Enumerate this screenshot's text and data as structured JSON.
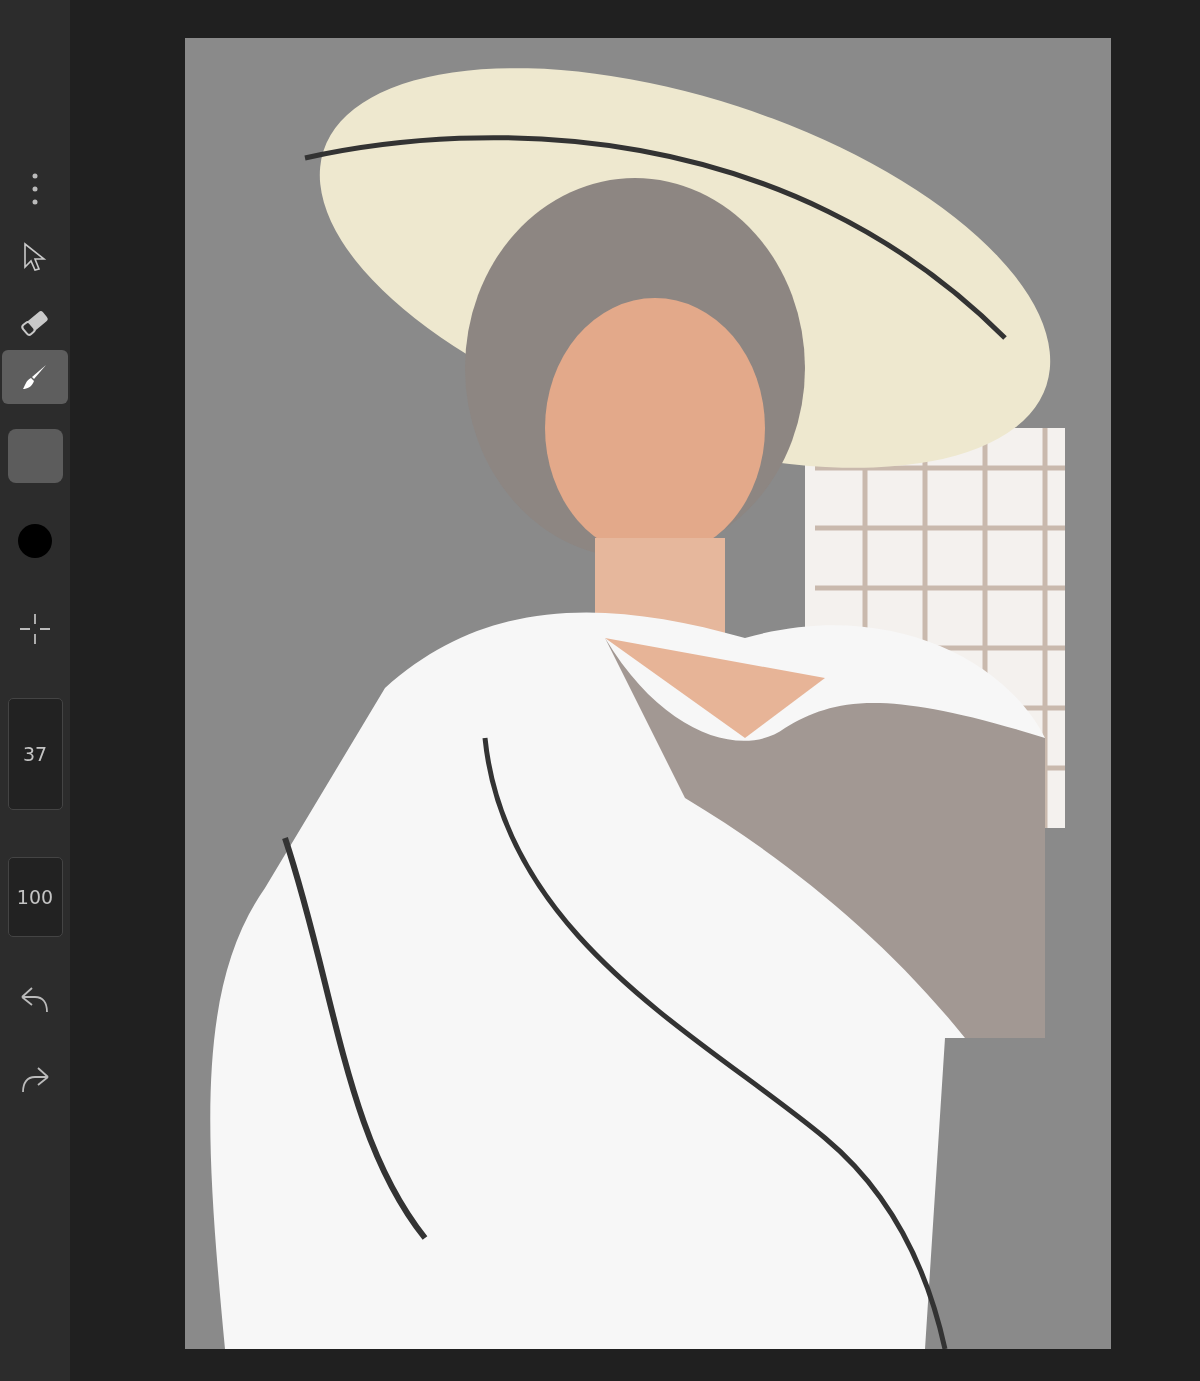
{
  "tools": [
    {
      "kind": "select",
      "selected": false
    },
    {
      "kind": "eraser",
      "selected": false
    },
    {
      "kind": "brush",
      "selected": true
    }
  ],
  "swatch": {
    "color": "#5c5c5c"
  },
  "current_color": {
    "color": "#000000"
  },
  "brush_size": "37",
  "opacity": "100"
}
